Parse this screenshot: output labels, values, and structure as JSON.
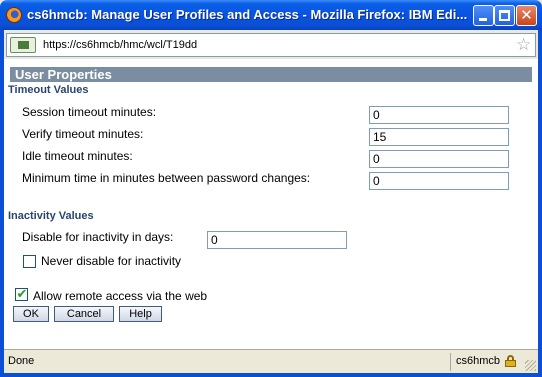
{
  "window": {
    "title": "cs6hmcb: Manage User Profiles and Access - Mozilla Firefox: IBM Edi...",
    "close_glyph": "✕"
  },
  "urlbar": {
    "url": "https://cs6hmcb/hmc/wcl/T19dd",
    "star_glyph": "☆"
  },
  "panel": {
    "header": "User Properties",
    "timeout_section": {
      "title": "Timeout Values",
      "fields": [
        {
          "label": "Session timeout minutes:",
          "value": "0"
        },
        {
          "label": "Verify timeout minutes:",
          "value": "15"
        },
        {
          "label": "Idle timeout minutes:",
          "value": "0"
        },
        {
          "label": "Minimum time in minutes between password changes:",
          "value": "0"
        }
      ]
    },
    "inactivity_section": {
      "title": "Inactivity Values",
      "disable_label": "Disable for inactivity in days:",
      "disable_value": "0",
      "never_disable_label": "Never disable for inactivity",
      "never_disable_checked": false
    },
    "remote_access": {
      "label": "Allow remote access via the web",
      "checked": true,
      "check_glyph": "✔"
    },
    "buttons": {
      "ok": "OK",
      "cancel": "Cancel",
      "help": "Help"
    }
  },
  "statusbar": {
    "status": "Done",
    "host": "cs6hmcb"
  },
  "colors": {
    "titlebar": "#0854e2",
    "header_bar": "#7b8ea1",
    "section_title": "#27456e"
  }
}
